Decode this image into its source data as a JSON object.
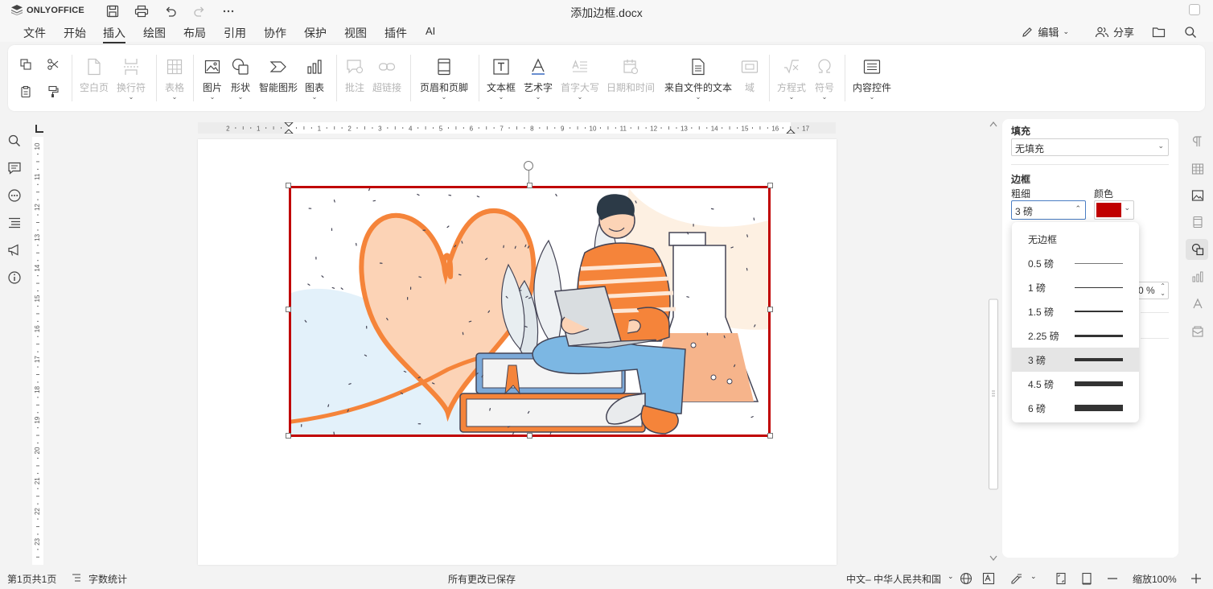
{
  "app": {
    "logo_text": "ONLYOFFICE",
    "doc_title": "添加边框.docx"
  },
  "menu": {
    "tabs": [
      "文件",
      "开始",
      "插入",
      "绘图",
      "布局",
      "引用",
      "协作",
      "保护",
      "视图",
      "插件",
      "AI"
    ],
    "active_tab": "插入",
    "edit_label": "编辑",
    "share_label": "分享"
  },
  "ribbon": {
    "blank_page": "空白页",
    "break": "换行符",
    "table": "表格",
    "image": "图片",
    "shape": "形状",
    "smartart": "智能图形",
    "chart": "图表",
    "comment": "批注",
    "hyperlink": "超链接",
    "header_footer": "页眉和页脚",
    "textbox": "文本框",
    "textart": "艺术字",
    "dropcap": "首字大写",
    "datetime": "日期和时间",
    "text_from_file": "来自文件的文本",
    "field": "域",
    "equation": "方程式",
    "symbol": "符号",
    "content_controls": "内容控件"
  },
  "ruler": {
    "h_labels": [
      "2",
      "1",
      "1",
      "2",
      "3",
      "4",
      "5",
      "6",
      "7",
      "8",
      "9",
      "10",
      "11",
      "12",
      "13",
      "14",
      "15",
      "16",
      "17"
    ],
    "v_labels": [
      "10",
      "11",
      "12",
      "13",
      "14",
      "15",
      "16",
      "17",
      "18",
      "19",
      "20",
      "21",
      "22",
      "23"
    ]
  },
  "panel": {
    "fill_title": "填充",
    "fill_value": "无填充",
    "border_title": "边框",
    "size_label": "粗细",
    "color_label": "颜色",
    "size_value": "3 磅",
    "border_color": "#c00000",
    "opacity_fragment": "0 %"
  },
  "dropdown": {
    "items": [
      {
        "label": "无边框",
        "weight": 0
      },
      {
        "label": "0.5 磅",
        "weight": 0.5
      },
      {
        "label": "1 磅",
        "weight": 1
      },
      {
        "label": "1.5 磅",
        "weight": 1.5
      },
      {
        "label": "2.25 磅",
        "weight": 2.25
      },
      {
        "label": "3 磅",
        "weight": 3
      },
      {
        "label": "4.5 磅",
        "weight": 4.5
      },
      {
        "label": "6 磅",
        "weight": 6
      }
    ],
    "selected": "3 磅"
  },
  "status": {
    "page_info": "第1页共1页",
    "word_count": "字数统计",
    "save_status": "所有更改已保存",
    "language": "中文– 中华人民共和国",
    "zoom": "缩放100%"
  },
  "colors": {
    "accent_border": "#c00000",
    "ruler_marker": "#333333",
    "illustration_orange": "#f5843a"
  }
}
